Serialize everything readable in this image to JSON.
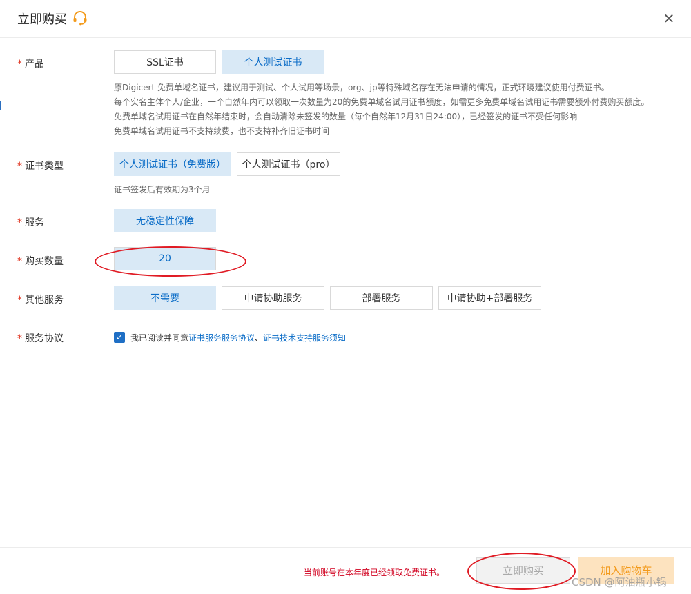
{
  "dialog": {
    "title": "立即购买",
    "icons": {
      "support": "headset-support-icon",
      "close": "close-icon"
    }
  },
  "product": {
    "label": "产品",
    "options": [
      "SSL证书",
      "个人测试证书"
    ],
    "selected": "个人测试证书",
    "desc": [
      "原Digicert 免费单域名证书，建议用于测试、个人试用等场景，org、jp等特殊域名存在无法申请的情况，正式环境建议使用付费证书。",
      "每个实名主体个人/企业，一个自然年内可以领取一次数量为20的免费单域名试用证书额度，如需更多免费单域名试用证书需要额外付费购买额度。",
      "免费单域名试用证书在自然年结束时，会自动清除未签发的数量（每个自然年12月31日24:00），已经签发的证书不受任何影响",
      "免费单域名试用证书不支持续费，也不支持补齐旧证书时间"
    ]
  },
  "cert_type": {
    "label": "证书类型",
    "options": [
      "个人测试证书（免费版）",
      "个人测试证书（pro）"
    ],
    "selected": "个人测试证书（免费版）",
    "note": "证书签发后有效期为3个月"
  },
  "service": {
    "label": "服务",
    "options": [
      "无稳定性保障"
    ],
    "selected": "无稳定性保障"
  },
  "quantity": {
    "label": "购买数量",
    "value": "20"
  },
  "other_service": {
    "label": "其他服务",
    "options": [
      "不需要",
      "申请协助服务",
      "部署服务",
      "申请协助+部署服务"
    ],
    "selected": "不需要"
  },
  "agreement": {
    "label": "服务协议",
    "checked": true,
    "prefix": "我已阅读并同意",
    "link1": "证书服务服务协议",
    "sep": "、",
    "link2": "证书技术支持服务须知"
  },
  "footer": {
    "notice": "当前账号在本年度已经领取免费证书。",
    "buy_label": "立即购买",
    "cart_label": "加入购物车"
  },
  "watermark": "CSDN @阿油瓶小锅",
  "colors": {
    "selected_bg": "#d9e9f6",
    "selected_text": "#0a6cc7",
    "required_star": "#e0321e",
    "notice": "#d1001f",
    "annotation_red": "#e01b24",
    "cart_bg": "#fde3bf",
    "cart_text": "#f39a1a"
  }
}
